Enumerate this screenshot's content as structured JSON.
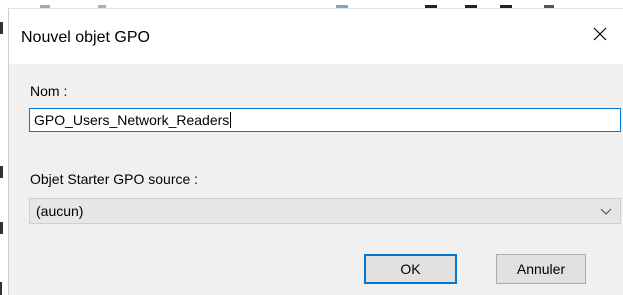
{
  "dialog": {
    "title": "Nouvel objet GPO",
    "name_label": "Nom :",
    "name_value": "GPO_Users_Network_Readers",
    "starter_label": "Objet Starter GPO source :",
    "starter_selected": "(aucun)",
    "ok_label": "OK",
    "cancel_label": "Annuler"
  },
  "colors": {
    "accent": "#0078d7",
    "client_bg": "#f0f0f0",
    "button_bg": "#e1e1e1"
  },
  "icons": {
    "close": "close-icon",
    "dropdown": "chevron-down-icon"
  }
}
